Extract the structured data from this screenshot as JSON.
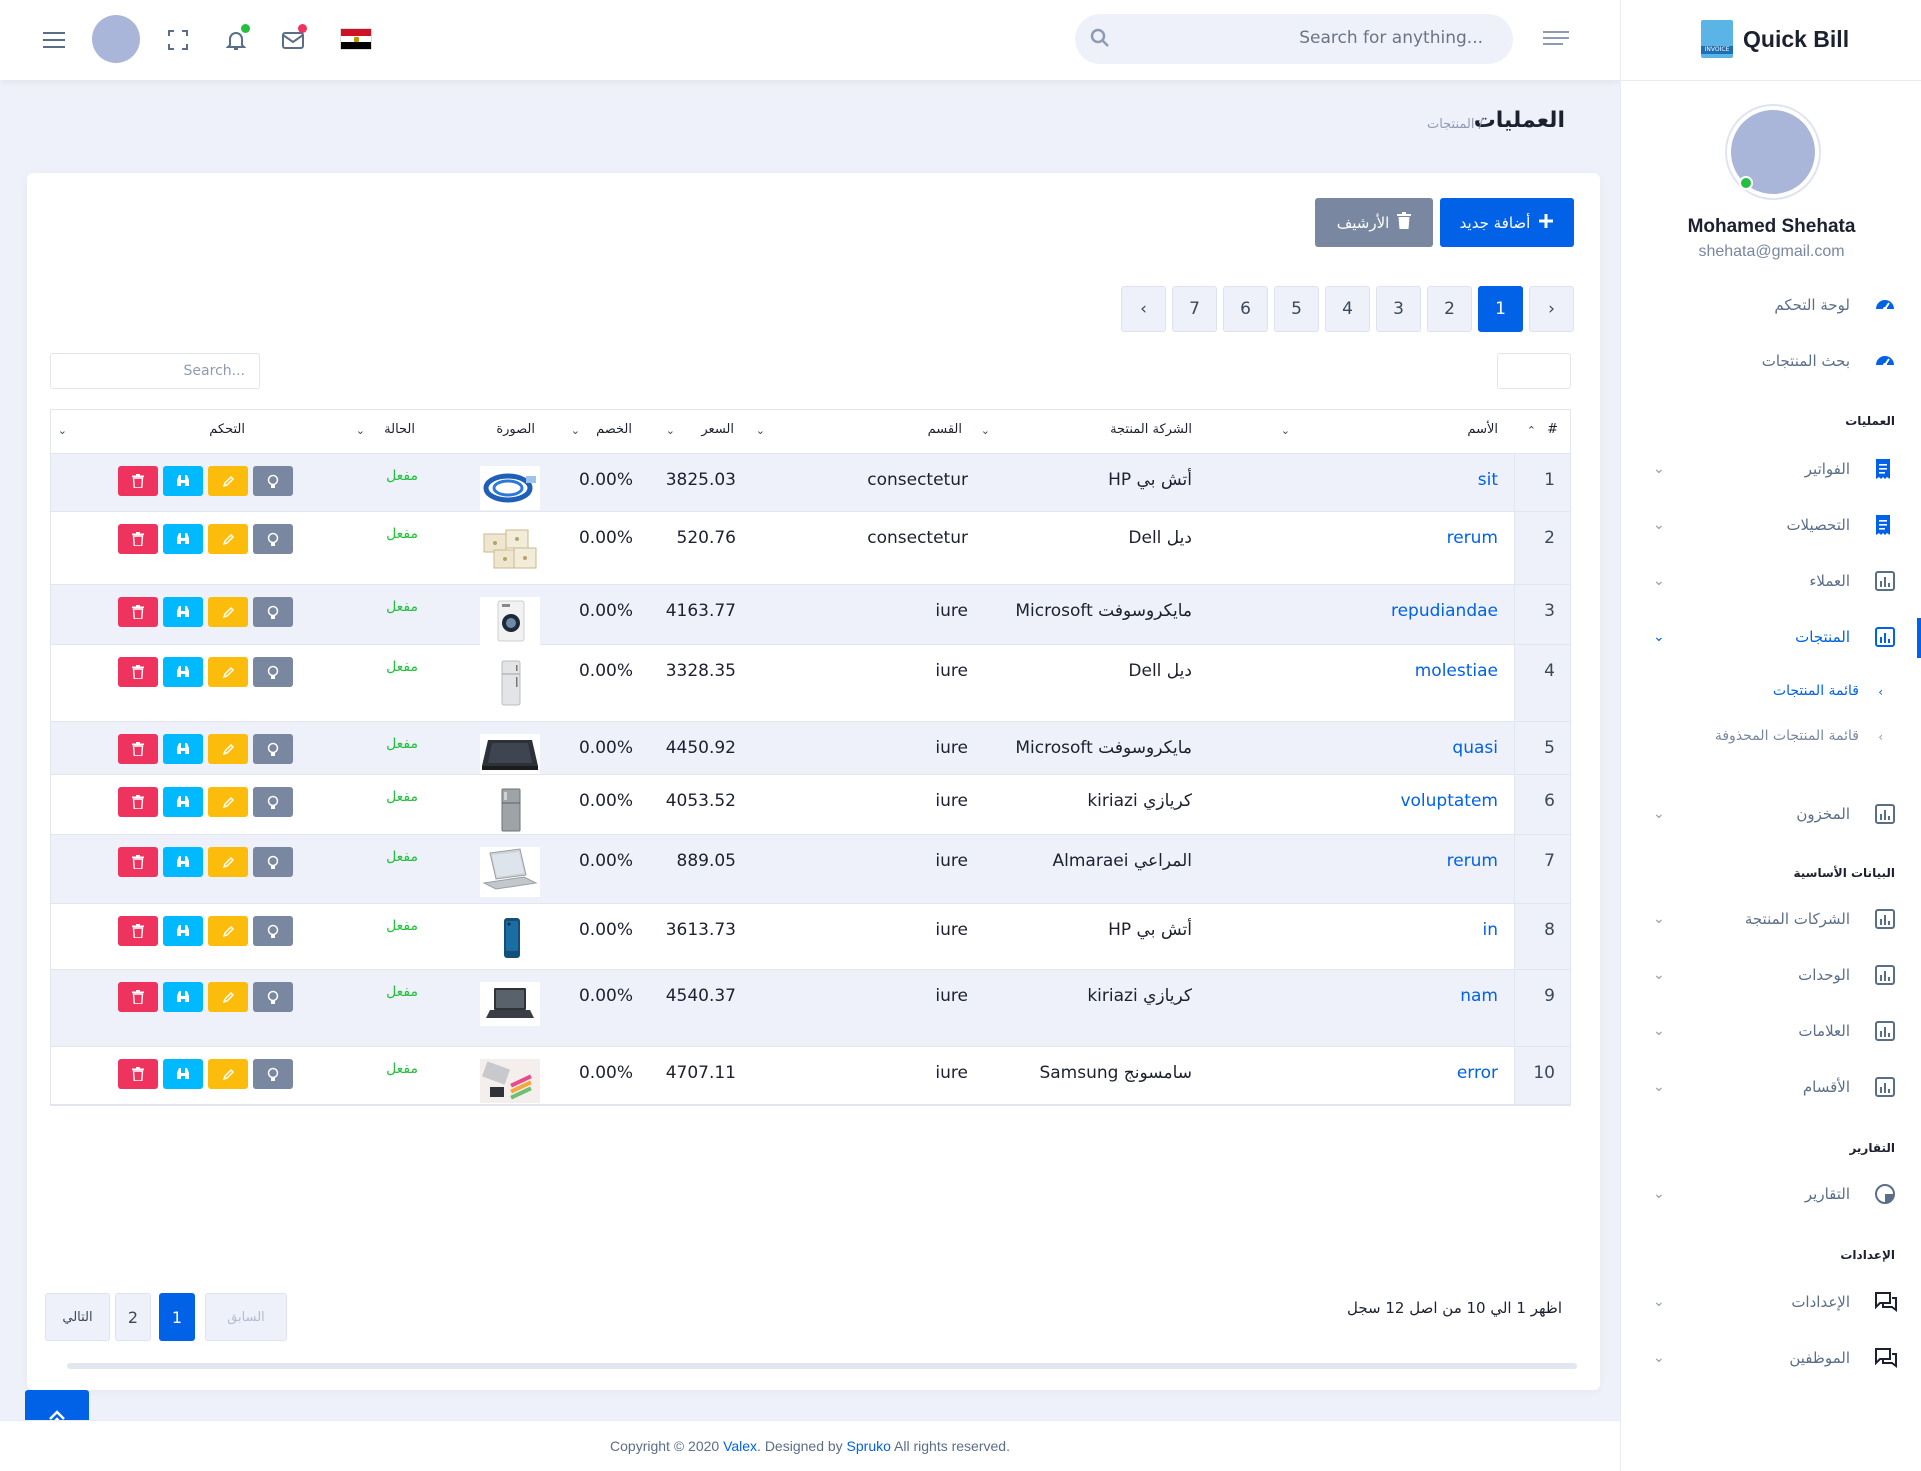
{
  "header": {
    "search_placeholder": "Search for anything...",
    "flag": "egypt-flag"
  },
  "sidebar": {
    "brand": "Quick Bill",
    "brand_icon_text": "INVOICE",
    "user_name": "Mohamed Shehata",
    "user_email": "shehata@gmail.com",
    "items_top": [
      {
        "label": "لوحة التحكم",
        "icon": "gauge-icon"
      },
      {
        "label": "بحث المنتجات",
        "icon": "gauge-icon"
      }
    ],
    "cat_ops": "العمليات",
    "ops_items": [
      {
        "label": "الفواتير",
        "icon": "receipt-icon"
      },
      {
        "label": "التحصيلات",
        "icon": "receipt-icon"
      },
      {
        "label": "العملاء",
        "icon": "bar-chart-icon"
      },
      {
        "label": "المنتجات",
        "icon": "bar-chart-icon",
        "active": true
      }
    ],
    "sub_items": [
      {
        "label": "قائمة المنتجات",
        "active": true
      },
      {
        "label": "قائمة المنتجات المحذوفة",
        "active": false
      }
    ],
    "stock_item": {
      "label": "المخزون",
      "icon": "bar-chart-icon"
    },
    "cat_basic": "البيانات الأساسية",
    "basic_items": [
      {
        "label": "الشركات المنتجة",
        "icon": "bar-chart-icon"
      },
      {
        "label": "الوحدات",
        "icon": "bar-chart-icon"
      },
      {
        "label": "العلامات",
        "icon": "bar-chart-icon"
      },
      {
        "label": "الأقسام",
        "icon": "bar-chart-icon"
      }
    ],
    "cat_reports": "التقارير",
    "reports_items": [
      {
        "label": "التقارير",
        "icon": "pie-chart-icon"
      }
    ],
    "cat_settings": "الإعدادات",
    "settings_items": [
      {
        "label": "الإعدادات",
        "icon": "chat-icon"
      },
      {
        "label": "الموظفين",
        "icon": "chat-icon"
      }
    ]
  },
  "breadcrumb": {
    "title": "العمليات",
    "sub": "/ المنتجات"
  },
  "toolbar": {
    "add_label": "أضافة جديد",
    "archive_label": "الأرشيف"
  },
  "top_pagination": {
    "prev": "‹",
    "next": "›",
    "pages": [
      "1",
      "2",
      "3",
      "4",
      "5",
      "6",
      "7"
    ],
    "active": "1"
  },
  "table": {
    "search_placeholder": "Search...",
    "headers": {
      "num": "#",
      "name": "الأسم",
      "company": "الشركة المنتجة",
      "category": "القسم",
      "price": "السعر",
      "discount": "الخصم",
      "image": "الصورة",
      "status": "الحالة",
      "control": "التحكم"
    },
    "rows": [
      {
        "num": "1",
        "name": "sit",
        "company": "أتش بي HP",
        "category": "consectetur",
        "price": "3825.03",
        "discount": "0.00%",
        "status": "مفعل",
        "image": "cable-image"
      },
      {
        "num": "2",
        "name": "rerum",
        "company": "ديل Dell",
        "category": "consectetur",
        "price": "520.76",
        "discount": "0.00%",
        "status": "مفعل",
        "image": "boxes-image"
      },
      {
        "num": "3",
        "name": "repudiandae",
        "company": "مايكروسوفت Microsoft",
        "category": "iure",
        "price": "4163.77",
        "discount": "0.00%",
        "status": "مفعل",
        "image": "washer-image"
      },
      {
        "num": "4",
        "name": "molestiae",
        "company": "ديل Dell",
        "category": "iure",
        "price": "3328.35",
        "discount": "0.00%",
        "status": "مفعل",
        "image": "fridge-image"
      },
      {
        "num": "5",
        "name": "quasi",
        "company": "مايكروسوفت Microsoft",
        "category": "iure",
        "price": "4450.92",
        "discount": "0.00%",
        "status": "مفعل",
        "image": "laptop-dark-image"
      },
      {
        "num": "6",
        "name": "voluptatem",
        "company": "كريازي kiriazi",
        "category": "iure",
        "price": "4053.52",
        "discount": "0.00%",
        "status": "مفعل",
        "image": "fridge-steel-image"
      },
      {
        "num": "7",
        "name": "rerum",
        "company": "المراعي Almaraei",
        "category": "iure",
        "price": "889.05",
        "discount": "0.00%",
        "status": "مفعل",
        "image": "laptop-silver-image"
      },
      {
        "num": "8",
        "name": "in",
        "company": "أتش بي HP",
        "category": "iure",
        "price": "3613.73",
        "discount": "0.00%",
        "status": "مفعل",
        "image": "phone-image"
      },
      {
        "num": "9",
        "name": "nam",
        "company": "كريازي kiriazi",
        "category": "iure",
        "price": "4540.37",
        "discount": "0.00%",
        "status": "مفعل",
        "image": "laptop-open-image"
      },
      {
        "num": "10",
        "name": "error",
        "company": "سامسونج Samsung",
        "category": "iure",
        "price": "4707.11",
        "discount": "0.00%",
        "status": "مفعل",
        "image": "accessories-image"
      }
    ]
  },
  "info": "اظهر 1 الي 10 من اصل 12 سجل",
  "bottom_pagination": {
    "prev": "السابق",
    "next": "التالي",
    "pages": [
      "1",
      "2"
    ],
    "active": "1"
  },
  "footer": {
    "prefix": "Copyright © 2020 ",
    "brand": "Valex",
    "middle": ". Designed by ",
    "designer": "Spruko",
    "suffix": " All rights reserved."
  },
  "colors": {
    "primary": "#0162e8",
    "danger": "#ee335e",
    "info": "#00b9ff",
    "warning": "#fbbc0b",
    "secondary": "#7987a1",
    "success": "#22c03c"
  }
}
